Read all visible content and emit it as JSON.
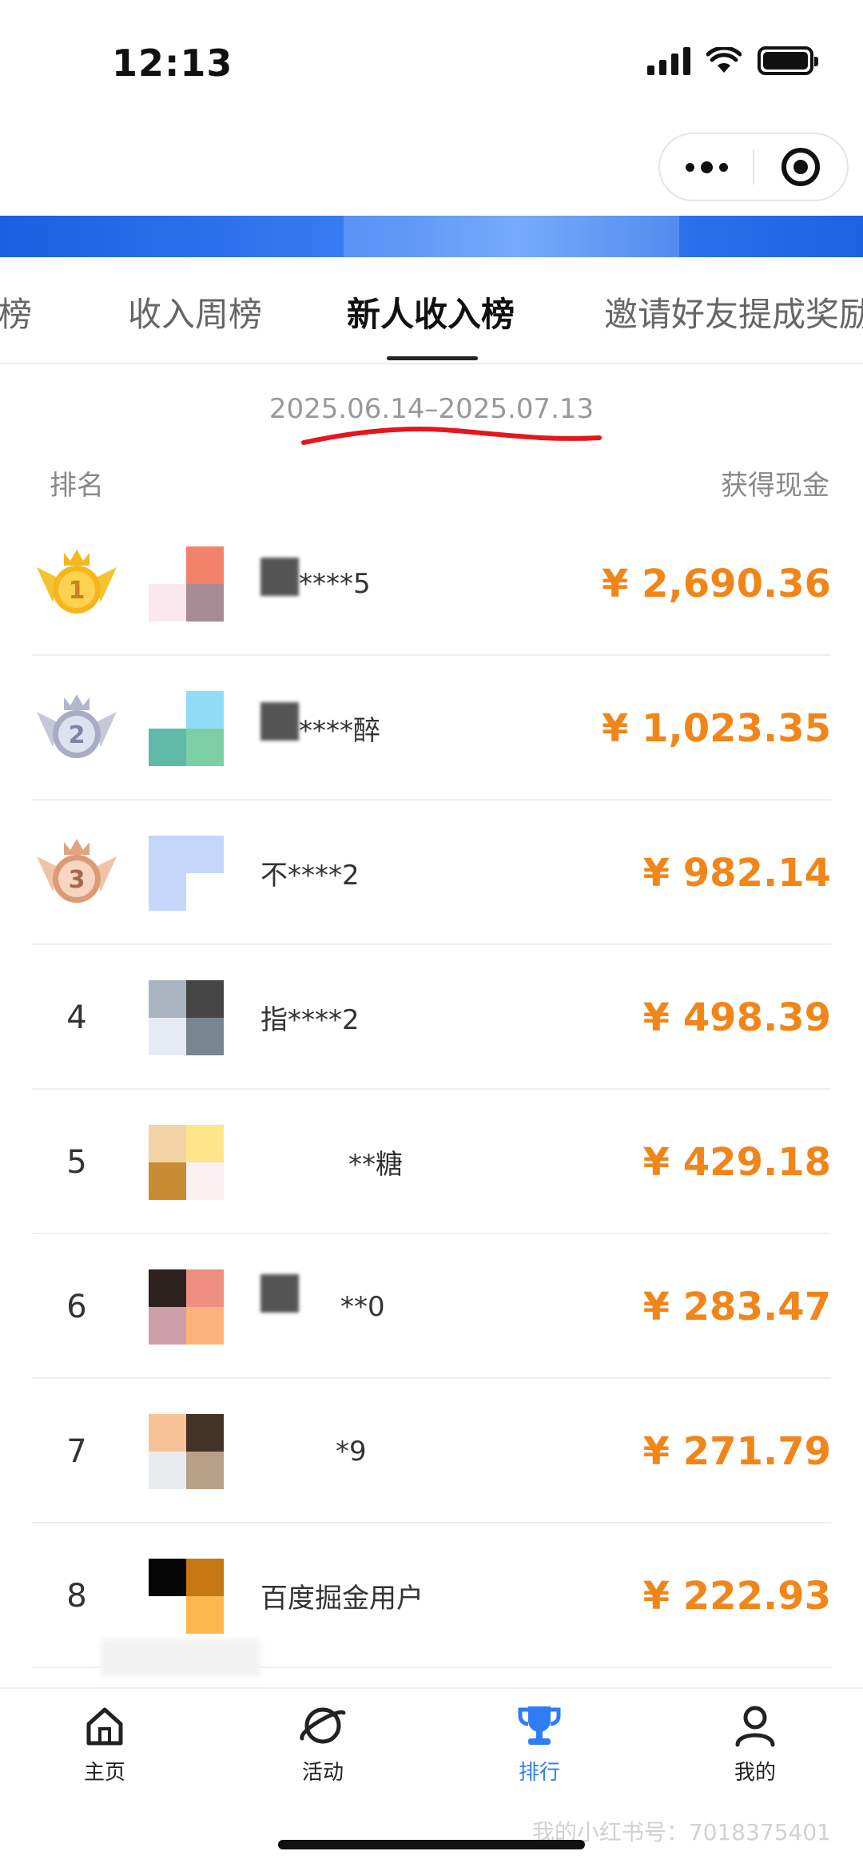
{
  "status_bar": {
    "time": "12:13"
  },
  "tabs": [
    {
      "label": "入榜",
      "active": false
    },
    {
      "label": "收入周榜",
      "active": false
    },
    {
      "label": "新人收入榜",
      "active": true
    },
    {
      "label": "邀请好友提成奖励",
      "active": false
    }
  ],
  "date_range": "2025.06.14–2025.07.13",
  "columns": {
    "rank": "排名",
    "amount": "获得现金"
  },
  "ranking": [
    {
      "rank": "1",
      "name": "****5",
      "amount": "¥ 2,690.36",
      "avatar": [
        "#ffffff",
        "#f4826a",
        "#fbe7ee",
        "#a88c95"
      ]
    },
    {
      "rank": "2",
      "name": "****醉",
      "amount": "¥ 1,023.35",
      "avatar": [
        "#ffffff",
        "#8fdcf8",
        "#5fb9a7",
        "#7ccfa4"
      ]
    },
    {
      "rank": "3",
      "name": "不****2",
      "amount": "¥ 982.14",
      "avatar": [
        "#c5d6fb",
        "#c5d6fb",
        "#c5d6fb",
        "#ffffff"
      ]
    },
    {
      "rank": "4",
      "name": "指****2",
      "amount": "¥ 498.39",
      "avatar": [
        "#aab4c0",
        "#454545",
        "#e5eaf5",
        "#79868f"
      ]
    },
    {
      "rank": "5",
      "name": "**糖",
      "amount": "¥ 429.18",
      "avatar": [
        "#f2d3a6",
        "#ffe58a",
        "#c98c32",
        "#f9f1f2"
      ]
    },
    {
      "rank": "6",
      "name": "**0",
      "amount": "¥ 283.47",
      "avatar": [
        "#2e2320",
        "#ee8f82",
        "#cc9ea9",
        "#fdb27a"
      ]
    },
    {
      "rank": "7",
      "name": "*9",
      "amount": "¥ 271.79",
      "avatar": [
        "#f7c396",
        "#433327",
        "#e9ebee",
        "#b7a087"
      ]
    },
    {
      "rank": "8",
      "name": "百度掘金用户",
      "amount": "¥ 222.93",
      "avatar": [
        "#050505",
        "#c77713",
        "#ffffff",
        "#ffb64e"
      ]
    }
  ],
  "bottom_nav": [
    {
      "label": "主页",
      "icon": "home-icon",
      "active": false
    },
    {
      "label": "活动",
      "icon": "planet-icon",
      "active": false
    },
    {
      "label": "排行",
      "icon": "trophy-icon",
      "active": true
    },
    {
      "label": "我的",
      "icon": "user-icon",
      "active": false
    }
  ],
  "watermark": "我的小红书号：7018375401",
  "colors": {
    "amount": "#f0861a",
    "active_nav": "#2f7df6",
    "banner": "#1a5fe0",
    "annotation": "#e5161c"
  }
}
